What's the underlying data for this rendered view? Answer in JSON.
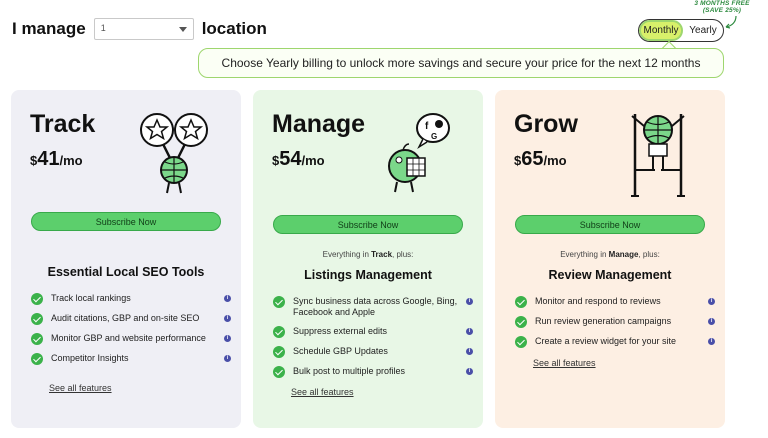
{
  "header": {
    "prefix": "I manage",
    "location_value": "1",
    "suffix": "location"
  },
  "billing_toggle": {
    "monthly": "Monthly",
    "yearly": "Yearly",
    "active": "Monthly",
    "promo_line1": "3 MONTHS FREE",
    "promo_line2": "(SAVE 25%)"
  },
  "banner": {
    "text": "Choose Yearly billing to unlock more savings and secure your price for the next 12 months"
  },
  "colors": {
    "accent_green": "#5ccf6c",
    "check_green": "#3bb24a",
    "info_blue": "#4a4fa8",
    "card_track_bg": "#efeff5",
    "card_manage_bg": "#e8f7e6",
    "card_grow_bg": "#fdefe3"
  },
  "plans": [
    {
      "name": "Track",
      "currency": "$",
      "amount": "41",
      "period": "/mo",
      "button": "Subscribe Now",
      "everything_prefix": "",
      "everything_plan": "",
      "everything_suffix": "",
      "section_title": "Essential Local SEO Tools",
      "features": [
        "Track local rankings",
        "Audit citations, GBP and on-site SEO",
        "Monitor GBP and website performance",
        "Competitor Insights"
      ],
      "see_all": "See all features",
      "mascot_icon": "magnifier-stars-mascot-icon"
    },
    {
      "name": "Manage",
      "currency": "$",
      "amount": "54",
      "period": "/mo",
      "button": "Subscribe Now",
      "everything_prefix": "Everything in ",
      "everything_plan": "Track",
      "everything_suffix": ", plus:",
      "section_title": "Listings Management",
      "features": [
        "Sync business data across Google, Bing, Facebook and Apple",
        "Suppress external edits",
        "Schedule GBP Updates",
        "Bulk post to multiple profiles"
      ],
      "see_all": "See all features",
      "mascot_icon": "speech-bubble-logos-mascot-icon"
    },
    {
      "name": "Grow",
      "currency": "$",
      "amount": "65",
      "period": "/mo",
      "button": "Subscribe Now",
      "everything_prefix": "Everything in ",
      "everything_plan": "Manage",
      "everything_suffix": ", plus:",
      "section_title": "Review Management",
      "features": [
        "Monitor and respond to reviews",
        "Run review generation campaigns",
        "Create a review widget for your site"
      ],
      "see_all": "See all features",
      "mascot_icon": "stilts-mascot-icon"
    }
  ]
}
